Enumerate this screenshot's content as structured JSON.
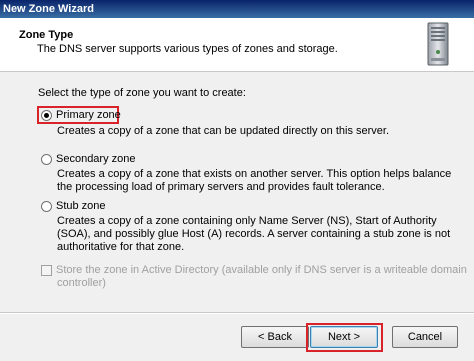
{
  "window": {
    "title": "New Zone Wizard"
  },
  "header": {
    "title": "Zone Type",
    "subtitle": "The DNS server supports various types of zones and storage.",
    "icon": "server-icon"
  },
  "prompt": "Select the type of zone you want to create:",
  "options": [
    {
      "label": "Primary zone",
      "checked": true,
      "desc": [
        "Creates a copy of a zone that can be updated directly on this server."
      ]
    },
    {
      "label": "Secondary zone",
      "checked": false,
      "desc": [
        "Creates a copy of a zone that exists on another server. This option helps balance",
        "the processing load of primary servers and provides fault tolerance."
      ]
    },
    {
      "label": "Stub zone",
      "checked": false,
      "desc": [
        "Creates a copy of a zone containing only Name Server (NS), Start of Authority",
        "(SOA), and possibly glue Host (A) records. A server containing a stub zone is not",
        "authoritative for that zone."
      ]
    }
  ],
  "ad_store": {
    "lines": [
      "Store the zone in Active Directory (available only if DNS server is a writeable domain",
      "controller)"
    ],
    "checked": false,
    "enabled": false
  },
  "buttons": {
    "back": "< Back",
    "next": "Next >",
    "cancel": "Cancel"
  },
  "colors": {
    "highlight": "#d8232a",
    "titlebar": "#0a246a"
  }
}
